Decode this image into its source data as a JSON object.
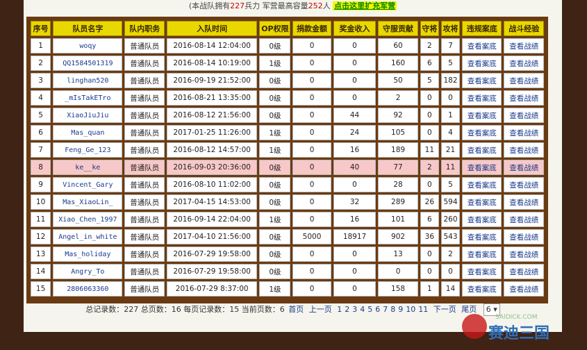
{
  "header": {
    "prefix": "(本战队拥有",
    "soldiers": "227",
    "mid": "兵力  军营最高容量",
    "capacity": "252",
    "suffix": "人 ",
    "expand_link": "点击这里扩充军营"
  },
  "columns": [
    "序号",
    "队员名字",
    "队内职务",
    "入队时间",
    "OP权限",
    "捐款金额",
    "奖金收入",
    "守服贡献",
    "守将",
    "攻将",
    "违规案底",
    "战斗经验"
  ],
  "rows": [
    {
      "no": "1",
      "name": "woqy",
      "role": "普通队员",
      "time": "2016-08-14 12:04:00",
      "op": "0级",
      "donate": "0",
      "bonus": "0",
      "contrib": "60",
      "def": "2",
      "atk": "7",
      "record": "查看案底",
      "exp": "查看战绩"
    },
    {
      "no": "2",
      "name": "QQ1584501319",
      "role": "普通队员",
      "time": "2016-08-14 10:19:00",
      "op": "1级",
      "donate": "0",
      "bonus": "0",
      "contrib": "160",
      "def": "6",
      "atk": "5",
      "record": "查看案底",
      "exp": "查看战绩"
    },
    {
      "no": "3",
      "name": "linghan520",
      "role": "普通队员",
      "time": "2016-09-19 21:52:00",
      "op": "0级",
      "donate": "0",
      "bonus": "0",
      "contrib": "50",
      "def": "5",
      "atk": "182",
      "record": "查看案底",
      "exp": "查看战绩"
    },
    {
      "no": "4",
      "name": "_mIsTakETro",
      "role": "普通队员",
      "time": "2016-08-21 13:35:00",
      "op": "0级",
      "donate": "0",
      "bonus": "0",
      "contrib": "2",
      "def": "0",
      "atk": "0",
      "record": "查看案底",
      "exp": "查看战绩"
    },
    {
      "no": "5",
      "name": "XiaoJiuJiu",
      "role": "普通队员",
      "time": "2016-08-12 21:56:00",
      "op": "0级",
      "donate": "0",
      "bonus": "44",
      "contrib": "92",
      "def": "0",
      "atk": "1",
      "record": "查看案底",
      "exp": "查看战绩"
    },
    {
      "no": "6",
      "name": "Mas_quan",
      "role": "普通队员",
      "time": "2017-01-25 11:26:00",
      "op": "1级",
      "donate": "0",
      "bonus": "24",
      "contrib": "105",
      "def": "0",
      "atk": "4",
      "record": "查看案底",
      "exp": "查看战绩"
    },
    {
      "no": "7",
      "name": "Feng_Ge_123",
      "role": "普通队员",
      "time": "2016-08-12 14:57:00",
      "op": "1级",
      "donate": "0",
      "bonus": "16",
      "contrib": "189",
      "def": "11",
      "atk": "21",
      "record": "查看案底",
      "exp": "查看战绩"
    },
    {
      "no": "8",
      "name": "ke__ke",
      "role": "普通队员",
      "time": "2016-09-03 20:36:00",
      "op": "0级",
      "donate": "0",
      "bonus": "40",
      "contrib": "77",
      "def": "2",
      "atk": "11",
      "record": "查看案底",
      "exp": "查看战绩"
    },
    {
      "no": "9",
      "name": "Vincent_Gary",
      "role": "普通队员",
      "time": "2016-08-10 11:02:00",
      "op": "0级",
      "donate": "0",
      "bonus": "0",
      "contrib": "28",
      "def": "0",
      "atk": "5",
      "record": "查看案底",
      "exp": "查看战绩"
    },
    {
      "no": "10",
      "name": "Mas_XiaoLin_",
      "role": "普通队员",
      "time": "2017-04-15 14:53:00",
      "op": "0级",
      "donate": "0",
      "bonus": "32",
      "contrib": "289",
      "def": "26",
      "atk": "594",
      "record": "查看案底",
      "exp": "查看战绩"
    },
    {
      "no": "11",
      "name": "Xiao_Chen_1997",
      "role": "普通队员",
      "time": "2016-09-14 22:04:00",
      "op": "1级",
      "donate": "0",
      "bonus": "16",
      "contrib": "101",
      "def": "6",
      "atk": "260",
      "record": "查看案底",
      "exp": "查看战绩"
    },
    {
      "no": "12",
      "name": "Angel_in_white",
      "role": "普通队员",
      "time": "2017-04-10 21:56:00",
      "op": "0级",
      "donate": "5000",
      "bonus": "18917",
      "contrib": "902",
      "def": "36",
      "atk": "543",
      "record": "查看案底",
      "exp": "查看战绩"
    },
    {
      "no": "13",
      "name": "Mas_holiday",
      "role": "普通队员",
      "time": "2016-07-29 19:58:00",
      "op": "0级",
      "donate": "0",
      "bonus": "0",
      "contrib": "13",
      "def": "0",
      "atk": "2",
      "record": "查看案底",
      "exp": "查看战绩"
    },
    {
      "no": "14",
      "name": "Angry_To",
      "role": "普通队员",
      "time": "2016-07-29 19:58:00",
      "op": "0级",
      "donate": "0",
      "bonus": "0",
      "contrib": "0",
      "def": "0",
      "atk": "0",
      "record": "查看案底",
      "exp": "查看战绩"
    },
    {
      "no": "15",
      "name": "2806063360",
      "role": "普通队员",
      "time": "2016-07-29 8:37:00",
      "op": "1级",
      "donate": "0",
      "bonus": "0",
      "contrib": "158",
      "def": "1",
      "atk": "14",
      "record": "查看案底",
      "exp": "查看战绩"
    }
  ],
  "highlight_row_index": 7,
  "footer": {
    "total_records": "总记录数：227",
    "total_pages": "总页数：16",
    "per_page": "每页记录数：15",
    "current_page": "当前页数：6",
    "first": "首页",
    "prev": "上一页",
    "pages": [
      "1",
      "2",
      "3",
      "4",
      "5",
      "6",
      "7",
      "8",
      "9",
      "10",
      "11"
    ],
    "next": "下一页",
    "last": "尾页",
    "select_value": "6"
  },
  "logo": {
    "text": "赛迪三国",
    "url_text": "SAIDICK.COM"
  },
  "colors": {
    "header_bg": "#e8d800",
    "frame": "#6a3b12",
    "highlight": "#f8c8c8",
    "link": "#1a3a8a"
  }
}
